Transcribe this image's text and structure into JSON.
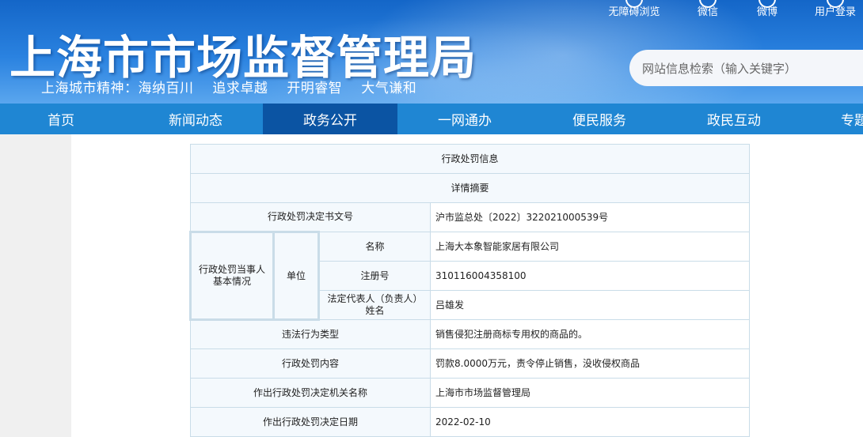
{
  "header": {
    "site_title": "上海市市场监督管理局",
    "slogan": [
      "上海城市精神：海纳百川",
      "追求卓越",
      "开明睿智",
      "大气谦和"
    ],
    "top_links": [
      {
        "label": "无障碍浏览",
        "icon": "accessibility-icon"
      },
      {
        "label": "微信",
        "icon": "wechat-icon"
      },
      {
        "label": "微博",
        "icon": "weibo-icon"
      },
      {
        "label": "用户登录",
        "icon": "user-icon"
      }
    ],
    "search_placeholder": "网站信息检索（输入关键字）"
  },
  "nav": {
    "items": [
      "首页",
      "新闻动态",
      "政务公开",
      "一网通办",
      "便民服务",
      "政民互动",
      "专题"
    ],
    "active_index": 2
  },
  "detail": {
    "title": "行政处罚信息",
    "subtitle": "详情摘要",
    "decision_no_label": "行政处罚决定书文号",
    "decision_no": "沪市监总处〔2022〕322021000539号",
    "party_label": "行政处罚当事人基本情况",
    "unit_label": "单位",
    "name_label": "名称",
    "name": "上海大本象智能家居有限公司",
    "reg_no_label": "注册号",
    "reg_no": "310116004358100",
    "legal_rep_label": "法定代表人（负责人）姓名",
    "legal_rep": "吕雄发",
    "violation_type_label": "违法行为类型",
    "violation_type": "销售侵犯注册商标专用权的商品的。",
    "penalty_label": "行政处罚内容",
    "penalty": "罚款8.0000万元，责令停止销售，没收侵权商品",
    "authority_label": "作出行政处罚决定机关名称",
    "authority": "上海市市场监督管理局",
    "date_label": "作出行政处罚决定日期",
    "date": "2022-02-10"
  },
  "colors": {
    "header_blue": "#1466c8",
    "nav_blue": "#1f86d3",
    "nav_active": "#0b54a3",
    "table_border": "#c9dce8",
    "label_cell_bg": "#f4f9fd"
  }
}
